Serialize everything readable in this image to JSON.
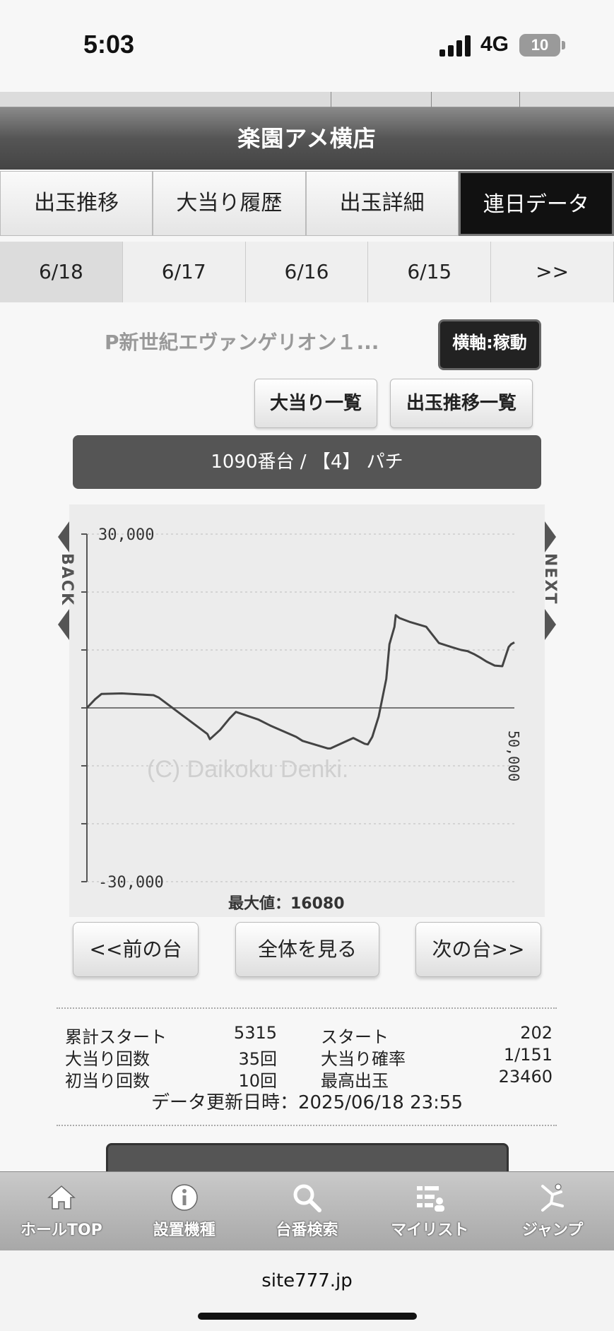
{
  "status": {
    "time": "5:03",
    "network": "4G",
    "battery": "10"
  },
  "header": {
    "title": "楽園アメ横店"
  },
  "tabs": [
    {
      "label": "出玉推移",
      "active": false
    },
    {
      "label": "大当り履歴",
      "active": false
    },
    {
      "label": "出玉詳細",
      "active": false
    },
    {
      "label": "連日データ",
      "active": true
    }
  ],
  "date_tabs": [
    {
      "label": "6/18",
      "active": true
    },
    {
      "label": "6/17",
      "active": false
    },
    {
      "label": "6/16",
      "active": false
    },
    {
      "label": "6/15",
      "active": false
    },
    {
      "label": ">>",
      "active": false
    }
  ],
  "model": {
    "name": "P新世紀エヴァンゲリオン１...",
    "axis_toggle": "横軸:稼動"
  },
  "actions": {
    "hit_list": "大当り一覧",
    "payout_list": "出玉推移一覧"
  },
  "machine": {
    "label": "1090番台 / 【4】 パチ"
  },
  "chart_data": {
    "type": "line",
    "ylim": [
      -30000,
      30000
    ],
    "tick_labels": {
      "top": "30,000",
      "bottom": "-30,000"
    },
    "x_max_label": "50,000",
    "watermark": "(C) Daikoku Denki.",
    "max_label": "最大値：16080",
    "series": [
      {
        "x": [
          0,
          1300,
          2300,
          5500,
          10500,
          11300,
          19000,
          19400,
          21000,
          22500,
          23500,
          27000,
          29000,
          33000,
          34000,
          38000,
          38400,
          42000,
          43800,
          44300,
          45000,
          46000,
          47200,
          47700,
          48500,
          48700,
          49300,
          51000,
          53500,
          55500,
          57500,
          59000,
          60000,
          61000,
          62000,
          63000,
          64300,
          65500,
          66500,
          66900,
          67400
        ],
        "y": [
          0,
          1500,
          2400,
          2500,
          2200,
          1800,
          -4500,
          -5400,
          -3800,
          -1800,
          -700,
          -2000,
          -3100,
          -5000,
          -5700,
          -7000,
          -7000,
          -5200,
          -6200,
          -6300,
          -5000,
          -1500,
          5000,
          11000,
          14000,
          16000,
          15500,
          14800,
          14000,
          11200,
          10500,
          10000,
          9800,
          9300,
          8700,
          8000,
          7300,
          7200,
          10500,
          11000,
          11300
        ]
      }
    ]
  },
  "chart_nav": {
    "back": "BACK",
    "next": "NEXT"
  },
  "navigation": {
    "prev": "<<前の台",
    "all": "全体を見る",
    "next": "次の台>>"
  },
  "stats": {
    "cumulative_start_label": "累計スタート",
    "cumulative_start_value": "5315",
    "start_label": "スタート",
    "start_value": "202",
    "hits_label": "大当り回数",
    "hits_value": "35回",
    "hit_prob_label": "大当り確率",
    "hit_prob_value": "1/151",
    "first_hits_label": "初当り回数",
    "first_hits_value": "10回",
    "max_payout_label": "最高出玉",
    "max_payout_value": "23460",
    "updated": "データ更新日時：2025/06/18 23:55"
  },
  "bottom_nav": [
    {
      "label": "ホールTOP",
      "icon": "home-icon"
    },
    {
      "label": "設置機種",
      "icon": "info-icon"
    },
    {
      "label": "台番検索",
      "icon": "search-icon"
    },
    {
      "label": "マイリスト",
      "icon": "list-icon"
    },
    {
      "label": "ジャンプ",
      "icon": "jump-icon"
    }
  ],
  "browser": {
    "url": "site777.jp"
  }
}
